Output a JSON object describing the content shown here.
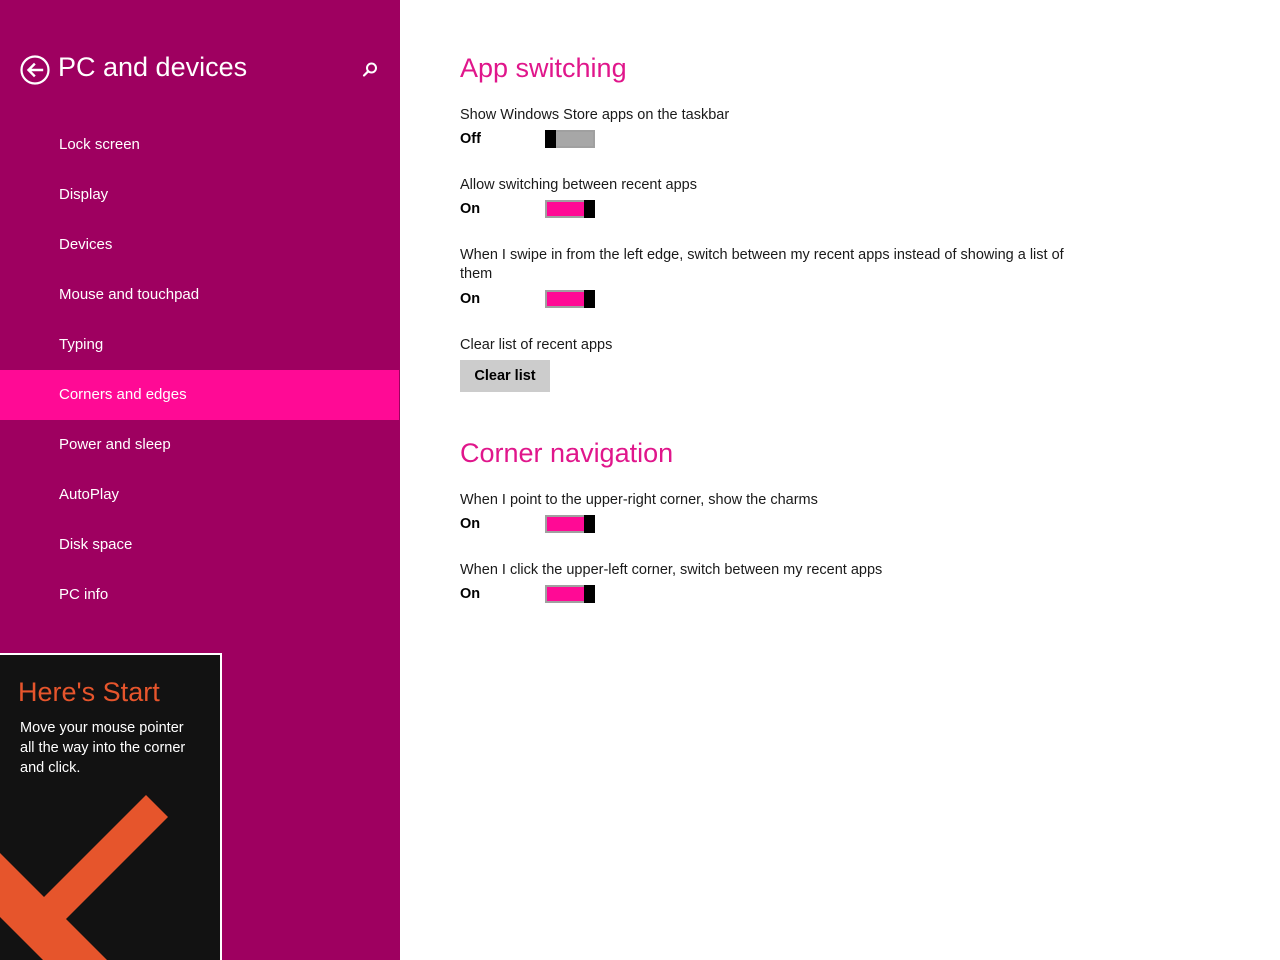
{
  "sidebar": {
    "title": "PC and devices",
    "back_icon": "back-arrow-icon",
    "search_icon": "search-icon",
    "items": [
      {
        "label": "Lock screen"
      },
      {
        "label": "Display"
      },
      {
        "label": "Devices"
      },
      {
        "label": "Mouse and touchpad"
      },
      {
        "label": "Typing"
      },
      {
        "label": "Corners and edges",
        "selected": true
      },
      {
        "label": "Power and sleep"
      },
      {
        "label": "AutoPlay"
      },
      {
        "label": "Disk space"
      },
      {
        "label": "PC info"
      }
    ],
    "colors": {
      "background": "#9e0060",
      "selected": "#ff0a95"
    }
  },
  "tip": {
    "title": "Here's Start",
    "body": "Move your mouse pointer all the way into the corner and click.",
    "arrow_icon": "arrow-down-left-icon",
    "colors": {
      "accent": "#e6552c",
      "background": "#121212"
    }
  },
  "main": {
    "app_switching": {
      "title": "App switching",
      "show_store_apps": {
        "label": "Show Windows Store apps on the taskbar",
        "state": "Off"
      },
      "allow_switching": {
        "label": "Allow switching between recent apps",
        "state": "On"
      },
      "swipe_left": {
        "label": "When I swipe in from the left edge, switch between my recent apps instead of showing a list of them",
        "state": "On"
      },
      "clear_list": {
        "label": "Clear list of recent apps",
        "button": "Clear list"
      }
    },
    "corner_navigation": {
      "title": "Corner navigation",
      "upper_right": {
        "label": "When I point to the upper-right corner, show the charms",
        "state": "On"
      },
      "upper_left": {
        "label": "When I click the upper-left corner, switch between my recent apps",
        "state": "On"
      }
    },
    "colors": {
      "accent": "#e0168b",
      "toggle_on": "#ff0a95",
      "toggle_off": "#a7a7a7"
    }
  }
}
